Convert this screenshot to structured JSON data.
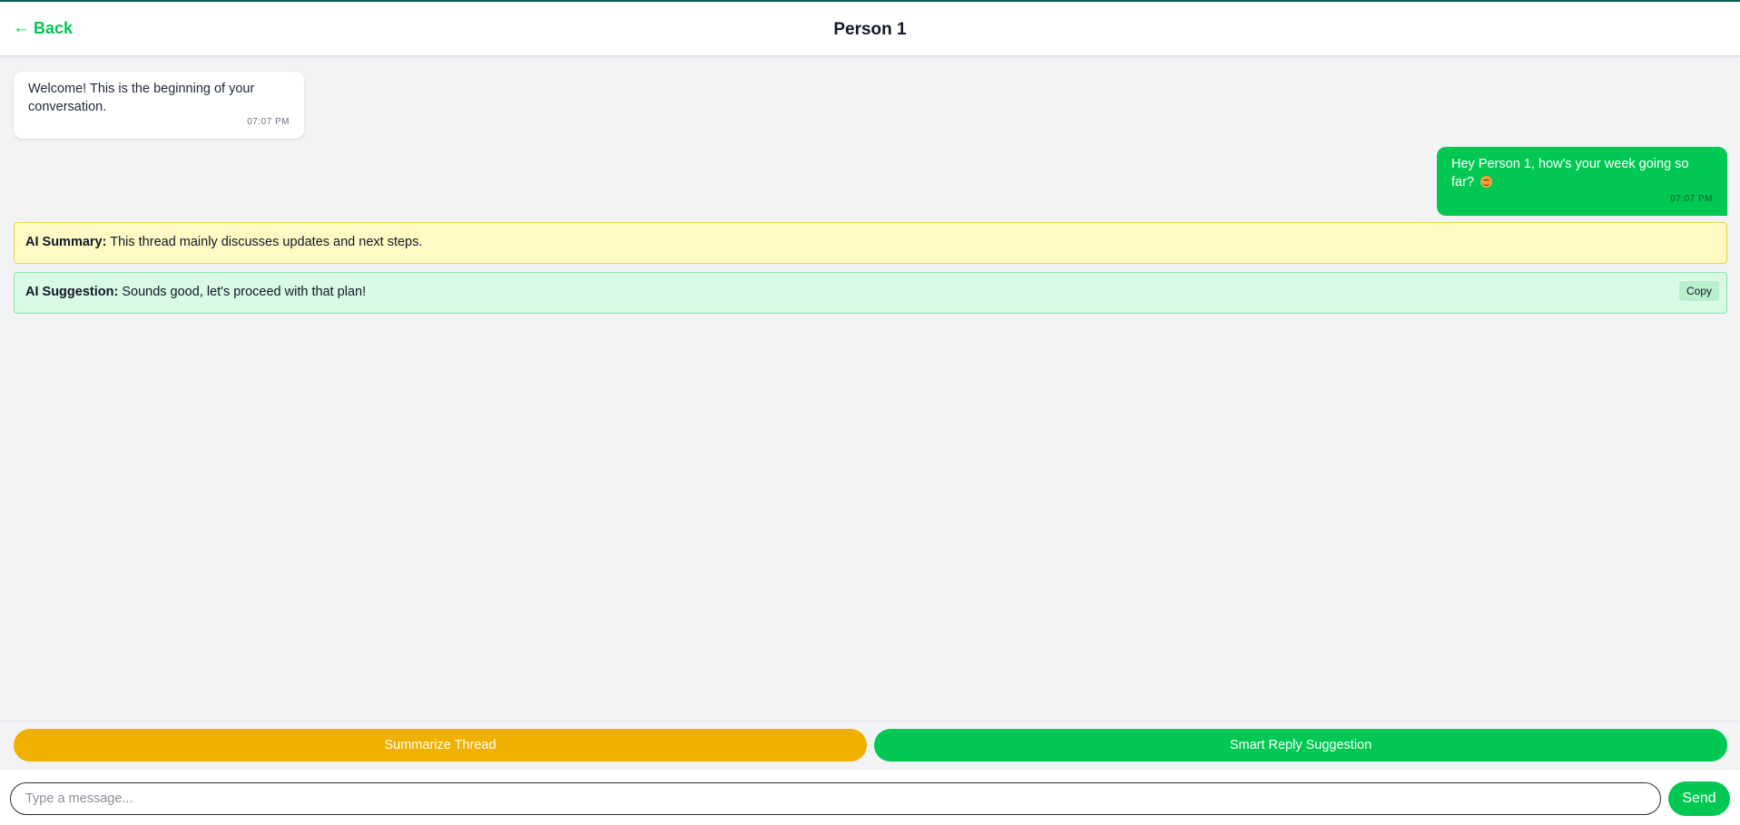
{
  "header": {
    "back_label": "Back",
    "back_icon": "←",
    "title": "Person 1"
  },
  "messages": [
    {
      "direction": "incoming",
      "text": "Welcome! This is the beginning of your conversation.",
      "time": "07:07 PM"
    },
    {
      "direction": "outgoing",
      "text": "Hey Person 1, how's your week going so far?",
      "emoji": "smiling-face-emoji",
      "time": "07:07 PM"
    }
  ],
  "ai_summary": {
    "label": "AI Summary:",
    "text": " This thread mainly discusses updates and next steps."
  },
  "ai_suggestion": {
    "label": "AI Suggestion:",
    "text": " Sounds good, let's proceed with that plan!",
    "copy_label": "Copy"
  },
  "actions": {
    "summarize_label": "Summarize Thread",
    "smart_reply_label": "Smart Reply Suggestion"
  },
  "composer": {
    "placeholder": "Type a message...",
    "value": "",
    "send_label": "Send"
  },
  "colors": {
    "accent_green": "#00c853",
    "summarize_yellow": "#f0b000",
    "summary_bg": "#fff9c4",
    "suggestion_bg": "#d9f9e5"
  }
}
